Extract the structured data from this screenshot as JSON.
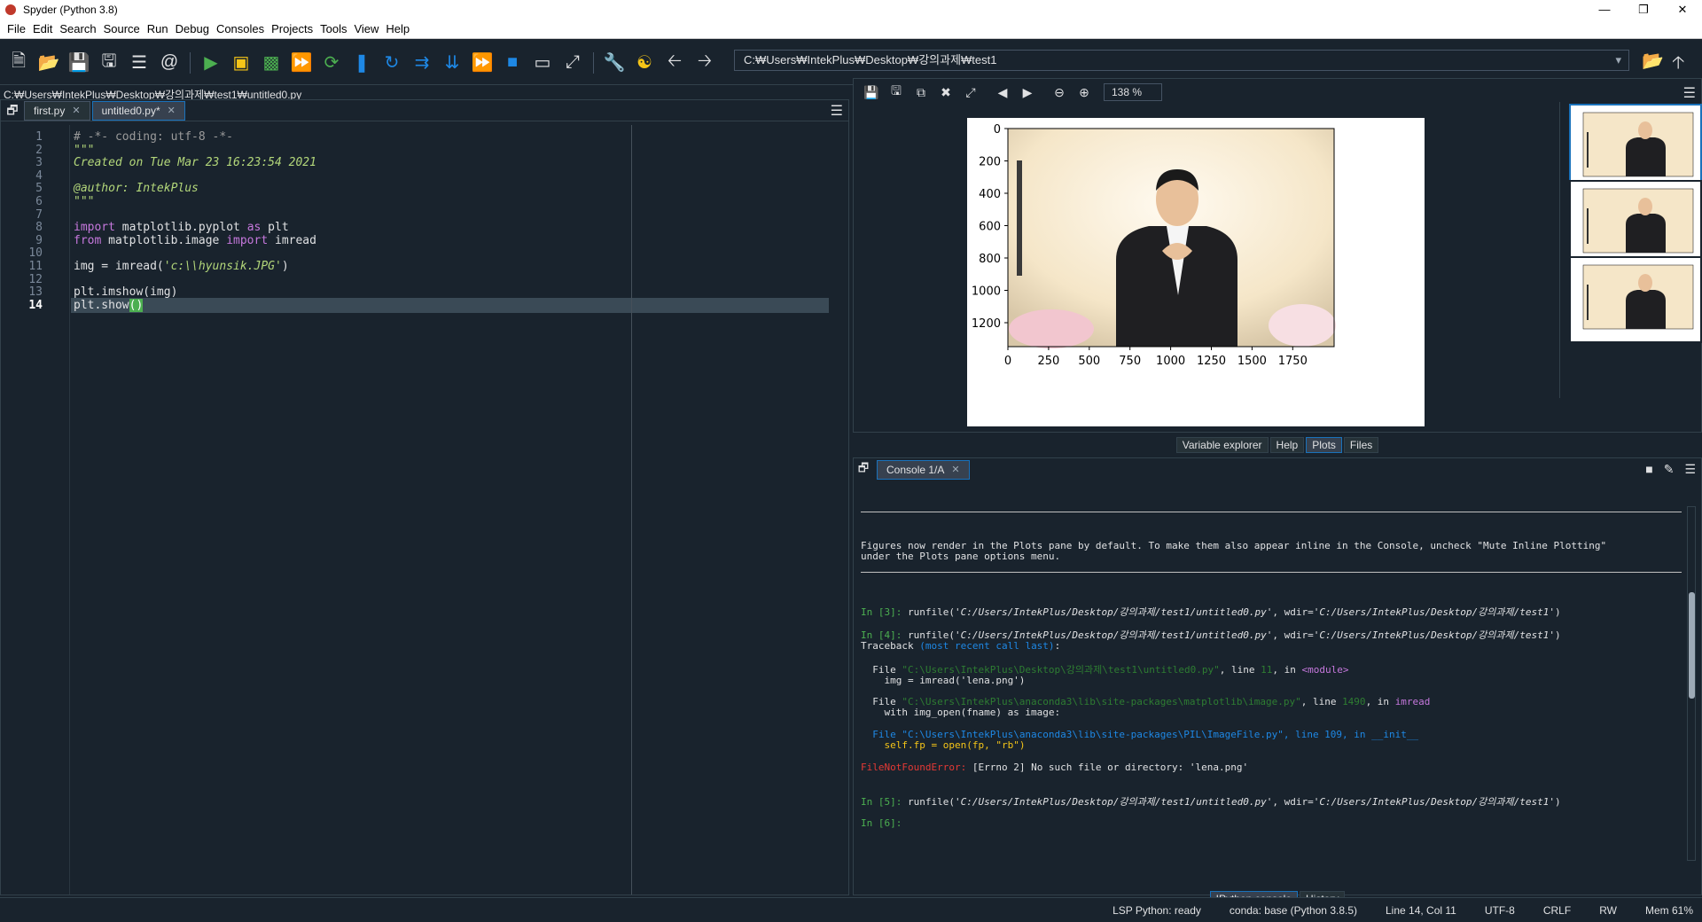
{
  "window": {
    "title": "Spyder (Python 3.8)"
  },
  "menu": [
    "File",
    "Edit",
    "Search",
    "Source",
    "Run",
    "Debug",
    "Consoles",
    "Projects",
    "Tools",
    "View",
    "Help"
  ],
  "toolbar": {
    "path": "C:₩Users₩IntekPlus₩Desktop₩강의과제₩test1",
    "icons": [
      "new-file-icon",
      "open-folder-icon",
      "save-icon",
      "save-all-icon",
      "outline-icon",
      "at-icon",
      "run-icon",
      "run-cell-icon",
      "run-cell-advance-icon",
      "run-selection-icon",
      "rerun-icon",
      "debug-step-icon",
      "debug-continue-icon",
      "debug-into-icon",
      "debug-return-icon",
      "debug-forward-icon",
      "stop-icon",
      "maximize-pane-icon",
      "fullscreen-icon",
      "wrench-icon",
      "python-icon",
      "back-arrow-icon",
      "forward-arrow-icon"
    ]
  },
  "editor": {
    "filepath": "C:₩Users₩IntekPlus₩Desktop₩강의과제₩test1₩untitled0.py",
    "tabs": [
      {
        "label": "first.py",
        "active": false
      },
      {
        "label": "untitled0.py*",
        "active": true
      }
    ],
    "lines": [
      {
        "n": "1",
        "html": "<span class='cm'># -*- coding: utf-8 -*-</span>"
      },
      {
        "n": "2",
        "html": "<span class='doc'>\"\"\"</span>"
      },
      {
        "n": "3",
        "html": "<span class='doc'>Created on Tue Mar 23 16:23:54 2021</span>"
      },
      {
        "n": "4",
        "html": ""
      },
      {
        "n": "5",
        "html": "<span class='doc'>@author: IntekPlus</span>"
      },
      {
        "n": "6",
        "html": "<span class='doc'>\"\"\"</span>"
      },
      {
        "n": "7",
        "html": ""
      },
      {
        "n": "8",
        "html": "<span class='kw'>import</span> matplotlib.pyplot <span class='kw'>as</span> plt"
      },
      {
        "n": "9",
        "html": "<span class='kw'>from</span> matplotlib.image <span class='kw'>import</span> imread"
      },
      {
        "n": "10",
        "html": ""
      },
      {
        "n": "11",
        "html": "img = imread(<span class='str'>'c:\\\\hyunsik.JPG'</span>)"
      },
      {
        "n": "12",
        "html": ""
      },
      {
        "n": "13",
        "html": "plt.imshow(img)"
      },
      {
        "n": "14",
        "html": "plt.show<span class='brk'>()</span>"
      }
    ],
    "current_line": "14"
  },
  "plots": {
    "zoom": "138 %",
    "tabs": [
      {
        "label": "Variable explorer",
        "active": false
      },
      {
        "label": "Help",
        "active": false
      },
      {
        "label": "Plots",
        "active": true
      },
      {
        "label": "Files",
        "active": false
      }
    ],
    "yticks": [
      "0",
      "200",
      "400",
      "600",
      "800",
      "1000",
      "1200"
    ],
    "xticks": [
      "0",
      "250",
      "500",
      "750",
      "1000",
      "1250",
      "1500",
      "1750"
    ]
  },
  "console": {
    "tab": "Console 1/A",
    "bottom_tabs": [
      {
        "label": "IPython console",
        "active": true
      },
      {
        "label": "History",
        "active": false
      }
    ],
    "lines": [
      {
        "y": 62,
        "html": "Figures now render in the Plots pane by default. To make them also appear inline in the Console, uncheck \"Mute Inline Plotting\""
      },
      {
        "y": 74,
        "html": "under the Plots pane options menu."
      },
      {
        "y": 135,
        "html": "<span class='prompt'>In [3]:</span> runfile(<span class='ipath'>'C:/Users/IntekPlus/Desktop/강의과제/test1/untitled0.py'</span>, wdir=<span class='ipath'>'C:/Users/IntekPlus/Desktop/강의과제/test1'</span>)"
      },
      {
        "y": 161,
        "html": "<span class='prompt'>In [4]:</span> runfile(<span class='ipath'>'C:/Users/IntekPlus/Desktop/강의과제/test1/untitled0.py'</span>, wdir=<span class='ipath'>'C:/Users/IntekPlus/Desktop/강의과제/test1'</span>)"
      },
      {
        "y": 175,
        "html": "Traceback <span class='tb1'>(most recent call last)</span>:"
      },
      {
        "y": 200,
        "html": "  File <span class='green'>\"C:\\Users\\IntekPlus\\Desktop\\강의과제\\test1\\untitled0.py\"</span>, line <span class='green'>11</span>, in <span class='kw'>&lt;module&gt;</span>"
      },
      {
        "y": 214,
        "html": "    img = imread('lena.png')"
      },
      {
        "y": 238,
        "html": "  File <span class='green'>\"C:\\Users\\IntekPlus\\anaconda3\\lib\\site-packages\\matplotlib\\image.py\"</span>, line <span class='green'>1490</span>, in <span class='kw'>imread</span>"
      },
      {
        "y": 250,
        "html": "    with img_open(fname) as image:"
      },
      {
        "y": 275,
        "html": "  <span class='tb1'>File \"C:\\Users\\IntekPlus\\anaconda3\\lib\\site-packages\\PIL\\ImageFile.py\", line 109, in __init__</span>"
      },
      {
        "y": 287,
        "html": "    <span class='y'>self.fp = open(fp, \"rb\")</span>"
      },
      {
        "y": 312,
        "html": "<span class='err'>FileNotFoundError:</span> [Errno 2] No such file or directory: 'lena.png'"
      },
      {
        "y": 349,
        "html": "<span class='prompt'>In [5]:</span> runfile(<span class='ipath'>'C:/Users/IntekPlus/Desktop/강의과제/test1/untitled0.py'</span>, wdir=<span class='ipath'>'C:/Users/IntekPlus/Desktop/강의과제/test1'</span>)"
      },
      {
        "y": 375,
        "html": "<span class='prompt'>In [6]:</span>"
      }
    ]
  },
  "status": {
    "lsp": "LSP Python: ready",
    "conda": "conda: base (Python 3.8.5)",
    "position": "Line 14, Col 11",
    "encoding": "UTF-8",
    "eol": "CRLF",
    "rw": "RW",
    "mem": "Mem 61%"
  }
}
